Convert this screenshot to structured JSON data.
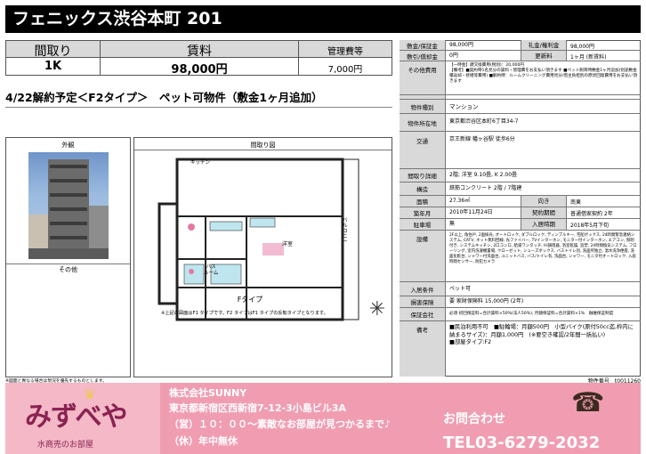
{
  "title": "フェニックス渋谷本町 201",
  "summary": {
    "headers": [
      "間取り",
      "賃料",
      "管理費等"
    ],
    "values": [
      "1K",
      "98,000円",
      "7,000円"
    ]
  },
  "headline": "4/22解約予定＜F2タイプ＞　ペット可物件（敷金1ヶ月追加）",
  "photo_label": "外観",
  "floorplan_label": "間取り図",
  "other_label": "その他",
  "floorplan": {
    "kitchen": "キッチン",
    "bath": "バス\nルーム",
    "room": "洋室",
    "balcony": "バルコニー",
    "type": "Fタイプ",
    "note": "※上記の図面はF1 タイプです。F2 タイプはF1 タイプの反転タイプとなります。"
  },
  "details": {
    "deposit_label": "敷金/保証金",
    "deposit": "98,000円",
    "keymoney_label": "礼金/権利金",
    "keymoney": "98,000円",
    "amort_label": "敷引/償却金",
    "amort": "0円",
    "renewal_label": "更新料",
    "renewal": "1ヶ月 (新賃料)",
    "other_fees_label": "その他費用",
    "other_fees": "【一時金】鍵交換費用(税別)：20,000円\n【備考】■契約時1名見分の賃料・管理費をお支払い頂きます ■ペット飼育時敷金1ヶ月追加(別途敷金積返却・修繕等費用) ■解約時：ルームクリーニング費用見分/借主負担別の原状回復費用をお支払い頂きます",
    "type_label": "物件種別",
    "type": "マンション",
    "address_label": "物件所在地",
    "address": "東京都渋谷区本町6丁目34-7",
    "transport_label": "交通",
    "transport": "京王新線 幡ヶ谷駅 徒歩6分",
    "layout_label": "間取り詳細",
    "layout": "2階; 洋室 9.10畳, K 2.00畳",
    "structure_label": "構造",
    "structure": "鉄筋コンクリート 2階 / 7階建",
    "area_label": "面積",
    "area": "27.36㎡",
    "direction_label": "向き",
    "direction": "南東",
    "built_label": "築年月",
    "built": "2010年11月24日",
    "contract_label": "契約期間",
    "contract": "普通借家契約 2年",
    "parking_label": "駐車場",
    "parking": "無",
    "movein_label": "入居時期",
    "movein": "2018年5月下旬",
    "equipment_label": "設備",
    "equipment": "2F以上, 角住戸, 2面採光, オートロック, ダブルロック, ディンプルキー, 宅配ボックス, 24時間緊急連絡システム, CATV, ネット無料回線, 光ファイバー, TVインターホン, モニター付インターホン, エアコン, 照明付き, システムキッチン, 2口コンロ, 給湯ワンタッチ, IH調理器, 浴室乾燥, 追焚, 24時間換気システム, フローリング, 室内洗濯機置場, クローゼット, シューズボックス, バストイレ別, 洗面所独立, 温水洗浄便座, 洗面化粧台, シャワー付洗面台, ユニットバス, バス/トイレ有, 洗面台, シャワー, モニタ付オートロック, 入居時間センサー, 防犯カメラ",
    "conditions_label": "入居条件",
    "conditions": "ペット可",
    "insurance_label": "損害保険",
    "insurance": "要 家財保険料 15,000円 (2年)",
    "guarantor_label": "保証会社",
    "guarantor": "必須 初回保証料=合計賃料×50%(法人50%), 月額保証料=合計賃料×1%　融維保証制度",
    "remarks_label": "備考",
    "remarks": "■民泊利用不可　■駐輪場：月額500円　小型バイク(原付50cc迄,枠内に納まるサイズ)：月額1,000円　(※要空き確認/2年間一括払い)\n■部屋タイプ:F2"
  },
  "footnote": "※図面と異なる場合は現況を優先するものとします。",
  "property_number": "物件番号　t0011260",
  "ad": {
    "logo": "みずべや",
    "logo_sub": "水商売のお部屋",
    "company": "株式会社SUNNY",
    "address": "東京都新宿区西新宿7-12-3小島ビル3A",
    "hours": "（営）１０：００～素敵なお部屋が見つかるまで♪",
    "holiday": "（休）年中無休",
    "contact_label": "お問合わせ",
    "tel": "TEL03-6279-2032"
  }
}
